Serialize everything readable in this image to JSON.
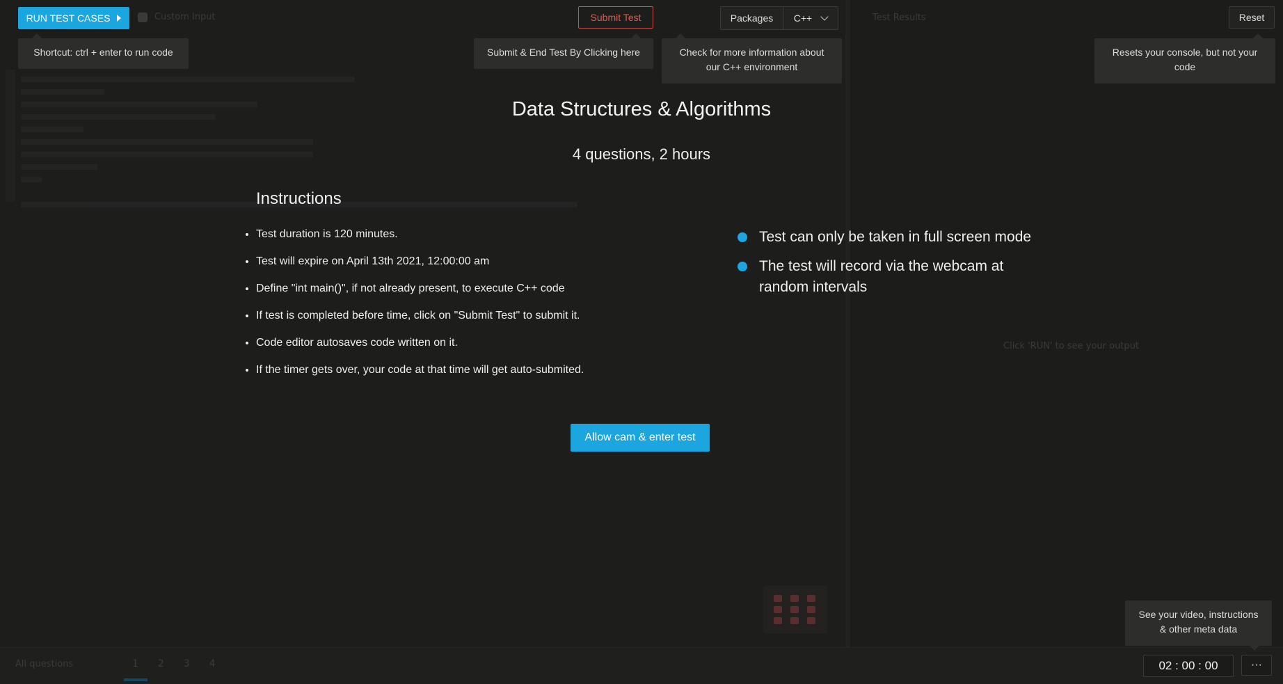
{
  "toolbar": {
    "run_label": "RUN TEST CASES",
    "custom_input_label": "Custom Input",
    "submit_label": "Submit Test",
    "packages_label": "Packages",
    "language": "C++",
    "results_label": "Test Results",
    "reset_label": "Reset"
  },
  "tooltips": {
    "run": "Shortcut: ctrl + enter to run code",
    "submit": "Submit & End Test By Clicking here",
    "packages": "Check for more information about our C++ environment",
    "reset": "Resets your console, but not your code",
    "more": "See your video, instructions & other meta data"
  },
  "overlay": {
    "title": "Data Structures & Algorithms",
    "subtitle": "4 questions, 2 hours",
    "instructions_heading": "Instructions",
    "instructions": [
      "Test duration is 120 minutes.",
      "Test will expire on April 13th 2021, 12:00:00 am",
      "Define \"int main()\", if not already present, to execute C++ code",
      "If test is completed before time, click on \"Submit Test\" to submit it.",
      "Code editor autosaves code written on it.",
      "If the timer gets over, your code at that time will get auto-submited."
    ],
    "notes": [
      "Test can only be taken in full screen mode",
      "The test will record via the webcam at random intervals"
    ],
    "allow_button": "Allow cam & enter test"
  },
  "results": {
    "hint": "Click 'RUN' to see your output"
  },
  "bottom": {
    "all_questions": "All questions",
    "question_numbers": [
      "1",
      "2",
      "3",
      "4"
    ],
    "timer": "02 : 00 : 00",
    "more_label": "···"
  },
  "colors": {
    "accent": "#1ba6e0",
    "submit": "#e05a50",
    "background": "#1b1b1a"
  }
}
